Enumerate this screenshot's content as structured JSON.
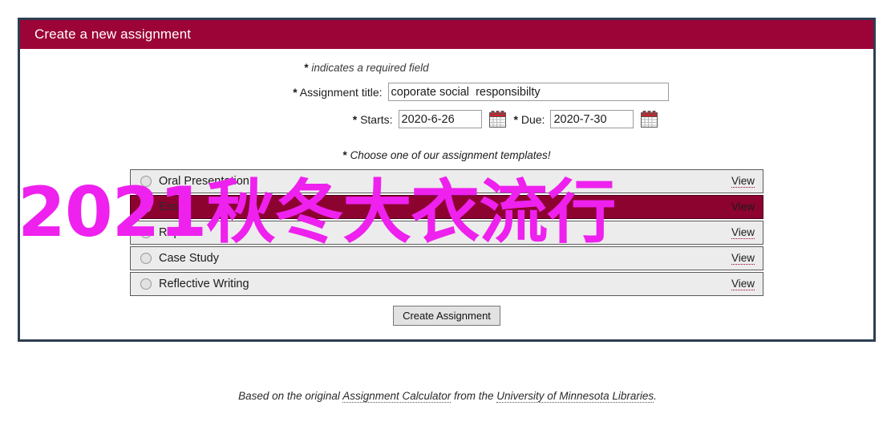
{
  "panel": {
    "header_title": "Create a new assignment",
    "required_note": "indicates a required field",
    "required_star": "*"
  },
  "form": {
    "title_label": "Assignment title:",
    "title_value": "coporate social  responsibilty",
    "title_placeholder": "",
    "starts_label": "Starts:",
    "starts_value": "2020-6-26",
    "due_label": "Due:",
    "due_value": "2020-7-30",
    "star": "*",
    "starts_calendar_icon": "calendar-icon",
    "due_calendar_icon": "calendar-icon"
  },
  "templates": {
    "choose_note": "Choose one of our assignment templates!",
    "choose_star": "*",
    "view_label": "View",
    "items": [
      {
        "label": "Oral Presentation",
        "selected": false,
        "view": "View"
      },
      {
        "label": "Essay",
        "selected": true,
        "view": "View"
      },
      {
        "label": "Report",
        "selected": false,
        "view": "View"
      },
      {
        "label": "Case Study",
        "selected": false,
        "view": "View"
      },
      {
        "label": "Reflective Writing",
        "selected": false,
        "view": "View"
      }
    ]
  },
  "actions": {
    "submit_label": "Create Assignment"
  },
  "footer": {
    "prefix": "Based on the original ",
    "link1": "Assignment Calculator",
    "middle": " from the ",
    "link2": "University of Minnesota Libraries",
    "suffix": "."
  },
  "watermark": {
    "text": "2021秋冬大衣流行",
    "color": "#ee21ee"
  },
  "colors": {
    "header_bg": "#9c0336",
    "selected_row_bg": "#8c0330",
    "panel_border": "#2e3e50",
    "row_bg": "#ececec"
  }
}
